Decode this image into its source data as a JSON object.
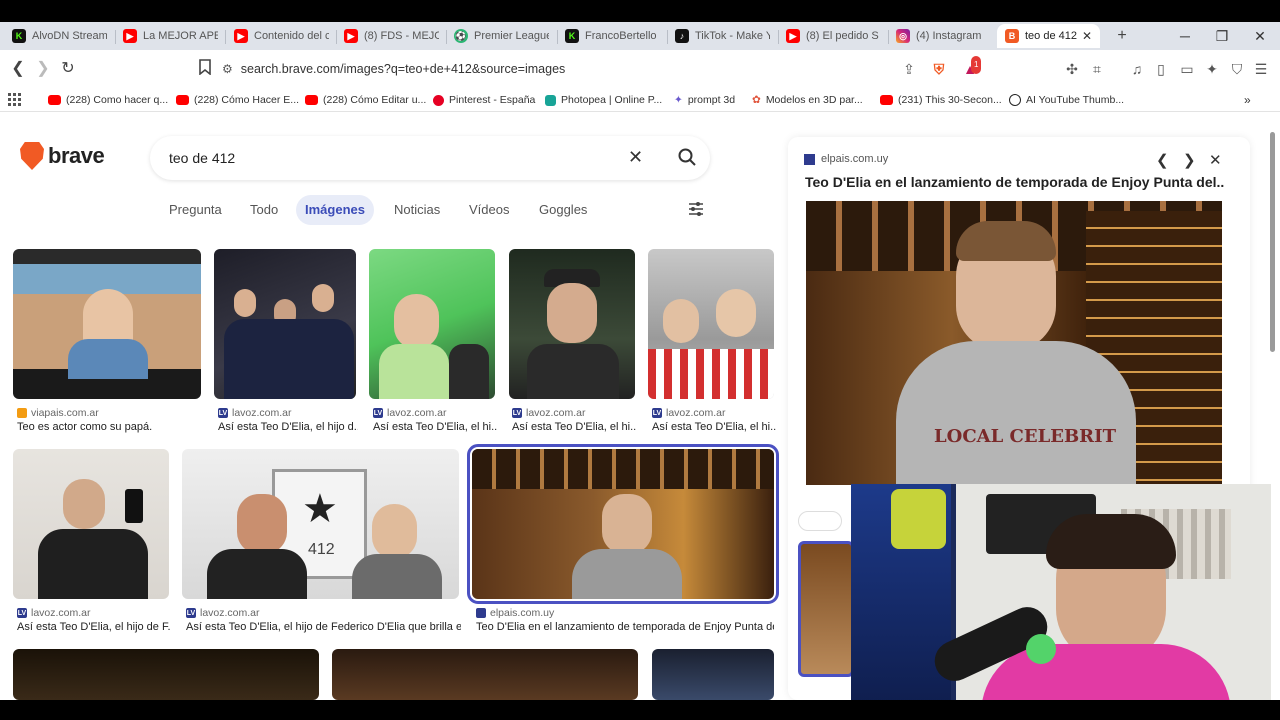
{
  "tabs": [
    {
      "title": "AlvoDN Stream",
      "icon": "kick-icon",
      "color": "#111111"
    },
    {
      "title": "La MEJOR APER",
      "icon": "youtube-icon",
      "color": "#ff0000"
    },
    {
      "title": "Contenido del c",
      "icon": "youtube-icon",
      "color": "#ff0000"
    },
    {
      "title": "(8) FDS - MEJO",
      "icon": "youtube-icon",
      "color": "#ff0000"
    },
    {
      "title": "Premier League",
      "icon": "premier-league-icon",
      "color": "#2bb673"
    },
    {
      "title": "FrancoBertello",
      "icon": "kick-icon",
      "color": "#111111"
    },
    {
      "title": "TikTok - Make Y",
      "icon": "tiktok-icon",
      "color": "#111111"
    },
    {
      "title": "(8) El pedido S",
      "icon": "youtube-icon",
      "color": "#ff0000"
    },
    {
      "title": "(4) Instagram",
      "icon": "instagram-icon",
      "color": "#d62976"
    },
    {
      "title": "teo de 412",
      "icon": "brave-icon",
      "color": "#f15a24"
    }
  ],
  "address": {
    "url": "search.brave.com/images?q=teo+de+412&source=images",
    "badge_count": "1"
  },
  "bookmarks": [
    {
      "label": "(228) Como hacer q...",
      "icon": "youtube-icon",
      "color": "#ff0000"
    },
    {
      "label": "(228) Cómo Hacer E...",
      "icon": "youtube-icon",
      "color": "#ff0000"
    },
    {
      "label": "(228) Cómo Editar u...",
      "icon": "youtube-icon",
      "color": "#ff0000"
    },
    {
      "label": "Pinterest - España",
      "icon": "pinterest-icon",
      "color": "#e60023"
    },
    {
      "label": "Photopea | Online P...",
      "icon": "photopea-icon",
      "color": "#18a497"
    },
    {
      "label": "prompt 3d",
      "icon": "sparkle-icon",
      "color": "#6a5acd"
    },
    {
      "label": "Modelos en 3D par...",
      "icon": "flower-icon",
      "color": "#e0533a"
    },
    {
      "label": "(231) This 30-Secon...",
      "icon": "youtube-icon",
      "color": "#ff0000"
    },
    {
      "label": "AI YouTube Thumb...",
      "icon": "ai-icon",
      "color": "#222222"
    }
  ],
  "brand": {
    "name": "brave",
    "color": "#f15a24"
  },
  "search": {
    "query": "teo de 412"
  },
  "filter_tabs": [
    "Pregunta",
    "Todo",
    "Imágenes",
    "Noticias",
    "Vídeos",
    "Goggles"
  ],
  "active_filter": "Imágenes",
  "results": [
    {
      "source": "viapais.com.ar",
      "caption": "Teo es actor como su papá."
    },
    {
      "source": "lavoz.com.ar",
      "caption": "Así esta Teo D'Elia, el hijo d..."
    },
    {
      "source": "lavoz.com.ar",
      "caption": "Así esta Teo D'Elia, el hi..."
    },
    {
      "source": "lavoz.com.ar",
      "caption": "Así esta Teo D'Elia, el hi..."
    },
    {
      "source": "lavoz.com.ar",
      "caption": "Así esta Teo D'Elia, el hi..."
    },
    {
      "source": "lavoz.com.ar",
      "caption": "Así esta Teo D'Elia, el hijo de F..."
    },
    {
      "source": "lavoz.com.ar",
      "caption": "Así esta Teo D'Elia, el hijo de Federico D'Elia que brilla e..."
    },
    {
      "source": "elpais.com.uy",
      "caption": "Teo D'Elia en el lanzamiento de temporada de Enjoy Punta de..."
    }
  ],
  "image_412_text": "412",
  "panel": {
    "source": "elpais.com.uy",
    "title": "Teo D'Elia en el lanzamiento de temporada de Enjoy Punta del...",
    "shirt_text": "LOCAL CELEBRIT"
  }
}
